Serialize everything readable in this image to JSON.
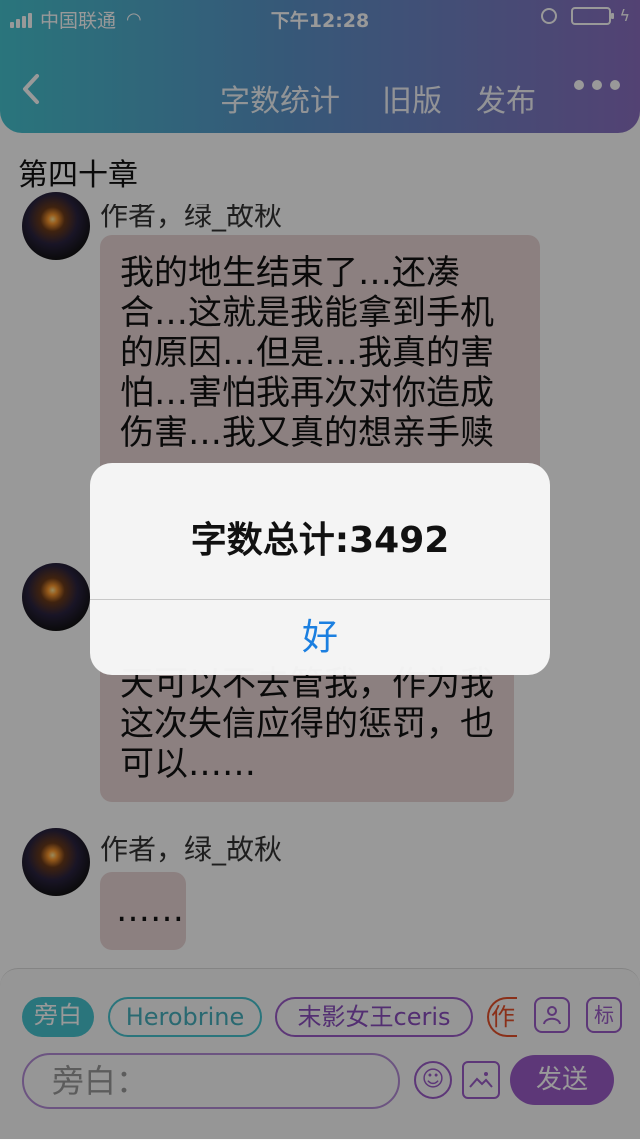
{
  "status": {
    "carrier": "中国联通",
    "time": "下午12:28",
    "battery_level": 0.4
  },
  "nav": {
    "back_icon": "chevron-left-icon",
    "word_count_label": "字数统计",
    "old_version_label": "旧版",
    "publish_label": "发布",
    "more_icon": "more-dots-icon"
  },
  "chapter": {
    "title": "第四十章"
  },
  "messages": [
    {
      "author": "作者，绿_故秋",
      "text": "我的地生结束了…还凑合…这就是我能拿到手机的原因…但是…我真的害怕…害怕我再次对你造成伤害…我又真的想亲手赎"
    },
    {
      "author": "",
      "text": "天可以不去管我，作为我这次失信应得的惩罚，也可以……"
    },
    {
      "author": "作者，绿_故秋",
      "text": "……"
    }
  ],
  "composer": {
    "chips": [
      "旁白",
      "Herobrine",
      "末影女王ceris",
      "作"
    ],
    "contact_icon": "person-icon",
    "tag_label": "标",
    "input_placeholder": "旁白：",
    "send_label": "发送"
  },
  "alert": {
    "title": "字数总计:3492",
    "ok_label": "好"
  },
  "colors": {
    "accent_teal": "#46c3cf",
    "accent_purple": "#9b5cc9",
    "alert_button": "#1b7fe0"
  }
}
